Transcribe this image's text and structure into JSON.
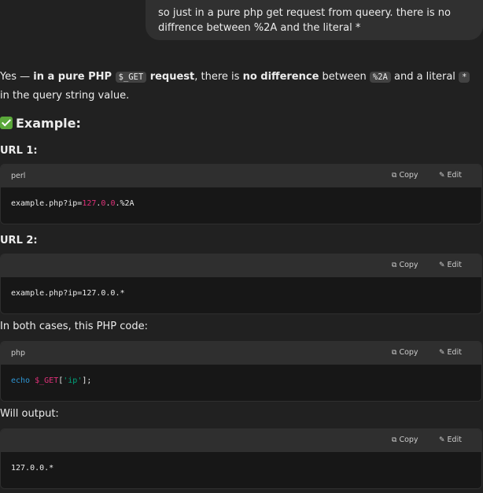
{
  "user_message": "so just in a pure php get request from queery. there is no diffrence between %2A and the literal *",
  "answer": {
    "p1_yes": "Yes — ",
    "p1_bold1": "in a pure PHP ",
    "p1_code1": "$_GET",
    "p1_bold2": " request",
    "p1_mid": ", there is ",
    "p1_bold3": "no difference",
    "p1_between": " between ",
    "p1_code2": "%2A",
    "p1_and": " and a literal ",
    "p1_code3": "*",
    "p1_end": " in the query string value.",
    "example_heading": "Example:",
    "url1_label": "URL 1:",
    "url2_label": "URL 2:",
    "both_cases": "In both cases, this PHP code:",
    "will_output": "Will output:"
  },
  "code_blocks": [
    {
      "lang": "perl",
      "tokens": [
        "example.php?ip=",
        "127",
        ".",
        "0",
        ".",
        "0",
        ".%2A"
      ]
    },
    {
      "lang": "",
      "code": "example.php?ip=127.0.0.*"
    },
    {
      "lang": "php",
      "tokens": [
        "echo",
        " ",
        "$_GET",
        "[",
        "'ip'",
        "];"
      ]
    },
    {
      "lang": "",
      "code": "127.0.0.*"
    }
  ],
  "buttons": {
    "copy_label": "Copy",
    "edit_label": "Edit",
    "copy_icon": "copy-icon",
    "edit_icon": "pencil-icon"
  },
  "colors": {
    "background": "#212121",
    "bubble": "#303030",
    "code_header": "#2f2f2f",
    "code_body": "#171717",
    "number": "#df3079",
    "keyword": "#2e95d3",
    "string": "#00a67d",
    "check": "#5aa83a"
  }
}
